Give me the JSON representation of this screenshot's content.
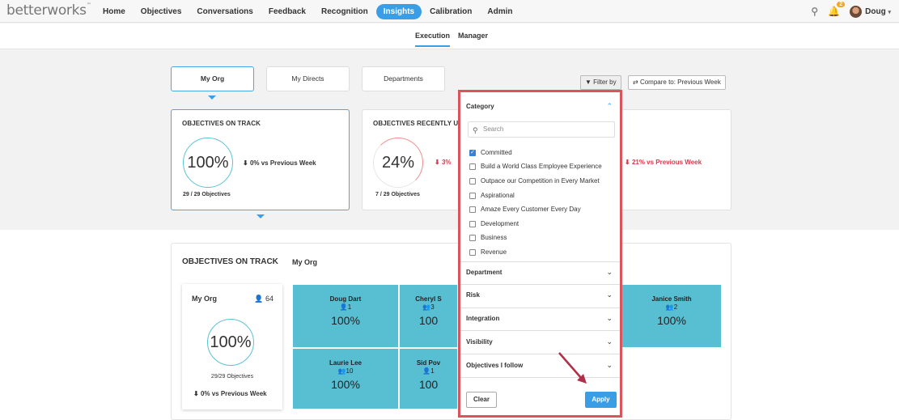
{
  "brand": {
    "logo_text": "betterworks"
  },
  "nav": {
    "items": [
      {
        "label": "Home"
      },
      {
        "label": "Objectives"
      },
      {
        "label": "Conversations"
      },
      {
        "label": "Feedback"
      },
      {
        "label": "Recognition"
      },
      {
        "label": "Insights"
      },
      {
        "label": "Calibration"
      },
      {
        "label": "Admin"
      }
    ],
    "user_name": "Doug",
    "notification_count": "2"
  },
  "subnav": {
    "tabs": [
      {
        "label": "Execution"
      },
      {
        "label": "Manager"
      }
    ]
  },
  "scope_tabs": [
    {
      "label": "My Org"
    },
    {
      "label": "My Directs"
    },
    {
      "label": "Departments"
    }
  ],
  "toolbar": {
    "filter_label": "Filter by",
    "compare_label": "Compare to: Previous Week"
  },
  "cards": [
    {
      "title": "OBJECTIVES ON TRACK",
      "value": "100%",
      "delta": "0% vs Previous Week",
      "count": "29 / 29 Objectives"
    },
    {
      "title": "OBJECTIVES RECENTLY U",
      "value": "24%",
      "delta": "3%",
      "count": "7 / 29 Objectives"
    },
    {
      "delta": "21% vs Previous Week"
    }
  ],
  "lower": {
    "title": "OBJECTIVES ON TRACK",
    "subtitle": "My Org",
    "org": {
      "name": "My Org",
      "people": "64",
      "value": "100%",
      "count": "29/29 Objectives",
      "delta": "0% vs Previous Week"
    },
    "tiles": [
      {
        "name": "Doug Dart",
        "people": "1",
        "value": "100%"
      },
      {
        "name": "Cheryl S",
        "people": "3",
        "value": "100"
      },
      {
        "name": "Janice Smith",
        "people": "2",
        "value": "100%"
      },
      {
        "name": "Laurie Lee",
        "people": "10",
        "value": "100%"
      },
      {
        "name": "Sid Pov",
        "people": "1",
        "value": "100"
      }
    ]
  },
  "filter_panel": {
    "category_label": "Category",
    "search_placeholder": "Search",
    "options": [
      {
        "label": "Committed",
        "checked": true
      },
      {
        "label": "Build a World Class Employee Experience",
        "checked": false
      },
      {
        "label": "Outpace our Competition in Every Market",
        "checked": false
      },
      {
        "label": "Aspirational",
        "checked": false
      },
      {
        "label": "Amaze Every Customer Every Day",
        "checked": false
      },
      {
        "label": "Development",
        "checked": false
      },
      {
        "label": "Business",
        "checked": false
      },
      {
        "label": "Revenue",
        "checked": false
      }
    ],
    "sections": [
      {
        "label": "Department"
      },
      {
        "label": "Risk"
      },
      {
        "label": "Integration"
      },
      {
        "label": "Visibility"
      },
      {
        "label": "Objectives I follow"
      }
    ],
    "clear_label": "Clear",
    "apply_label": "Apply"
  },
  "colors": {
    "accent": "#3a9ee6",
    "tile": "#58bfd3",
    "ring": "#59c3d4",
    "negative": "#d93a4b",
    "highlight_border": "#d9545c"
  }
}
